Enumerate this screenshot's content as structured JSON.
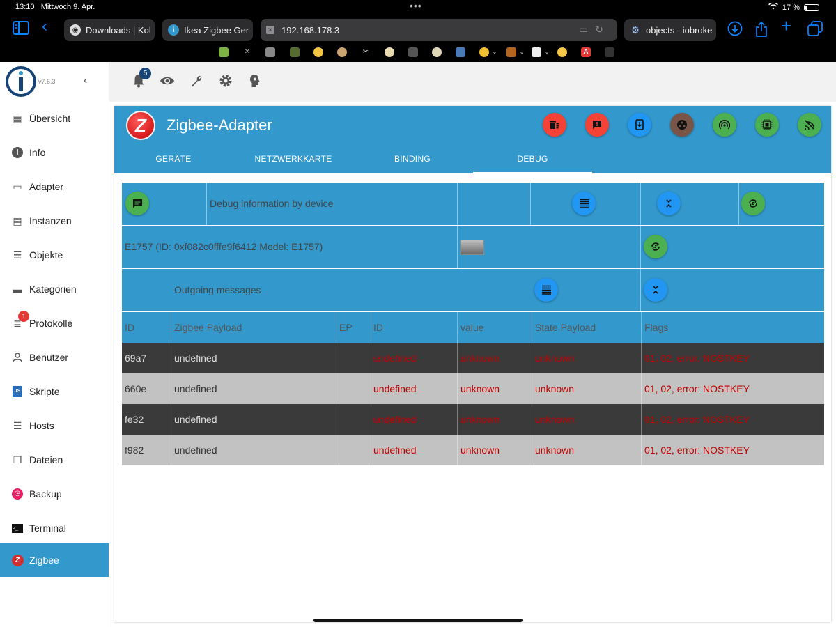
{
  "status_bar": {
    "time": "13:10",
    "date": "Mittwoch 9. Apr.",
    "wifi_icon": "wifi-icon",
    "battery": "17 %"
  },
  "browser": {
    "tabs": [
      {
        "title": "Downloads | Kol",
        "icon": "github-icon"
      },
      {
        "title": "Ikea Zigbee Ger",
        "icon": "iobroker-icon"
      },
      {
        "title": "objects - iobroke",
        "icon": "gear-icon"
      }
    ],
    "address": "192.168.178.3"
  },
  "sidebar": {
    "version": "v7.6.3",
    "items": [
      {
        "label": "Übersicht",
        "icon": "grid-icon"
      },
      {
        "label": "Info",
        "icon": "info-icon"
      },
      {
        "label": "Adapter",
        "icon": "store-icon"
      },
      {
        "label": "Instanzen",
        "icon": "instances-icon"
      },
      {
        "label": "Objekte",
        "icon": "list-icon"
      },
      {
        "label": "Kategorien",
        "icon": "category-icon"
      },
      {
        "label": "Protokolle",
        "icon": "log-icon",
        "badge": "1"
      },
      {
        "label": "Benutzer",
        "icon": "user-icon"
      },
      {
        "label": "Skripte",
        "icon": "js-icon"
      },
      {
        "label": "Hosts",
        "icon": "hosts-icon"
      },
      {
        "label": "Dateien",
        "icon": "files-icon"
      },
      {
        "label": "Backup",
        "icon": "backup-icon"
      },
      {
        "label": "Terminal",
        "icon": "terminal-icon"
      },
      {
        "label": "Zigbee",
        "icon": "zigbee-icon"
      }
    ]
  },
  "toolbar": {
    "notifications_count": "5"
  },
  "panel": {
    "title": "Zigbee-Adapter",
    "tabs": [
      "GERÄTE",
      "NETZWERKKARTE",
      "BINDING",
      "DEBUG"
    ],
    "active_tab": "DEBUG",
    "header_button_colors": [
      "#f44336",
      "#f44336",
      "#2196f3",
      "#795548",
      "#4caf50",
      "#4caf50",
      "#4caf50"
    ]
  },
  "debug": {
    "title": "Debug information by device",
    "device": "E1757 (ID: 0xf082c0fffe9f6412 Model: E1757)",
    "outgoing_label": "Outgoing messages",
    "columns": [
      "ID",
      "Zigbee Payload",
      "EP",
      "ID",
      "value",
      "State Payload",
      "Flags"
    ],
    "rows": [
      {
        "id": "69a7",
        "zigbee_payload": "undefined",
        "ep": "",
        "attr_id": "undefined",
        "value": "unknown",
        "state_payload": "unknown",
        "flags": "01, 02, error: NOSTKEY"
      },
      {
        "id": "660e",
        "zigbee_payload": "undefined",
        "ep": "",
        "attr_id": "undefined",
        "value": "unknown",
        "state_payload": "unknown",
        "flags": "01, 02, error: NOSTKEY"
      },
      {
        "id": "fe32",
        "zigbee_payload": "undefined",
        "ep": "",
        "attr_id": "undefined",
        "value": "unknown",
        "state_payload": "unknown",
        "flags": "01, 02, error: NOSTKEY"
      },
      {
        "id": "f982",
        "zigbee_payload": "undefined",
        "ep": "",
        "attr_id": "undefined",
        "value": "unknown",
        "state_payload": "unknown",
        "flags": "01, 02, error: NOSTKEY"
      }
    ]
  }
}
